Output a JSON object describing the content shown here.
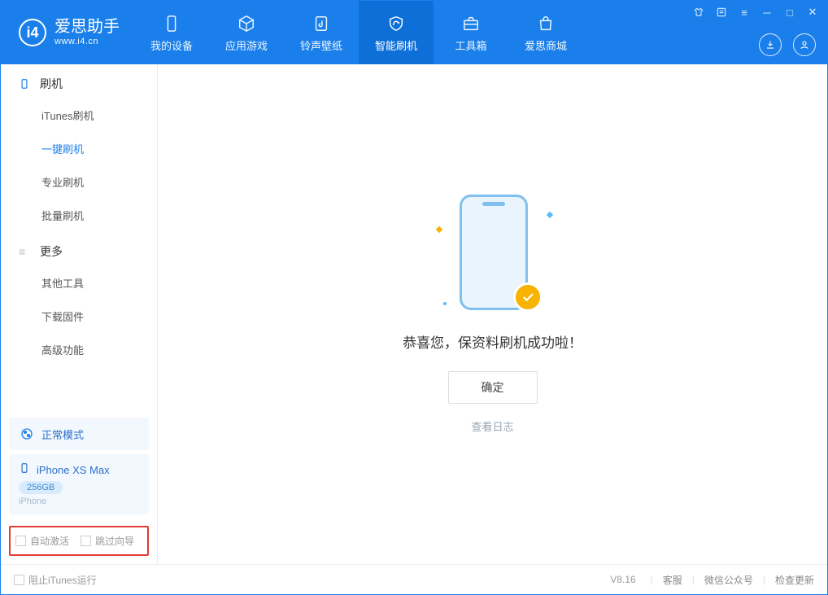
{
  "app": {
    "title": "爱思助手",
    "subtitle": "www.i4.cn"
  },
  "nav": {
    "items": [
      {
        "label": "我的设备"
      },
      {
        "label": "应用游戏"
      },
      {
        "label": "铃声壁纸"
      },
      {
        "label": "智能刷机"
      },
      {
        "label": "工具箱"
      },
      {
        "label": "爱思商城"
      }
    ]
  },
  "sidebar": {
    "groups": [
      {
        "title": "刷机",
        "items": [
          "iTunes刷机",
          "一键刷机",
          "专业刷机",
          "批量刷机"
        ]
      },
      {
        "title": "更多",
        "items": [
          "其他工具",
          "下载固件",
          "高级功能"
        ]
      }
    ],
    "mode": "正常模式",
    "device": {
      "name": "iPhone XS Max",
      "capacity": "256GB",
      "type": "iPhone"
    },
    "options": {
      "auto_activate": "自动激活",
      "skip_guide": "跳过向导"
    }
  },
  "main": {
    "success_message": "恭喜您，保资料刷机成功啦！",
    "ok_button": "确定",
    "view_log": "查看日志"
  },
  "footer": {
    "block_itunes": "阻止iTunes运行",
    "version": "V8.16",
    "links": [
      "客服",
      "微信公众号",
      "检查更新"
    ]
  }
}
